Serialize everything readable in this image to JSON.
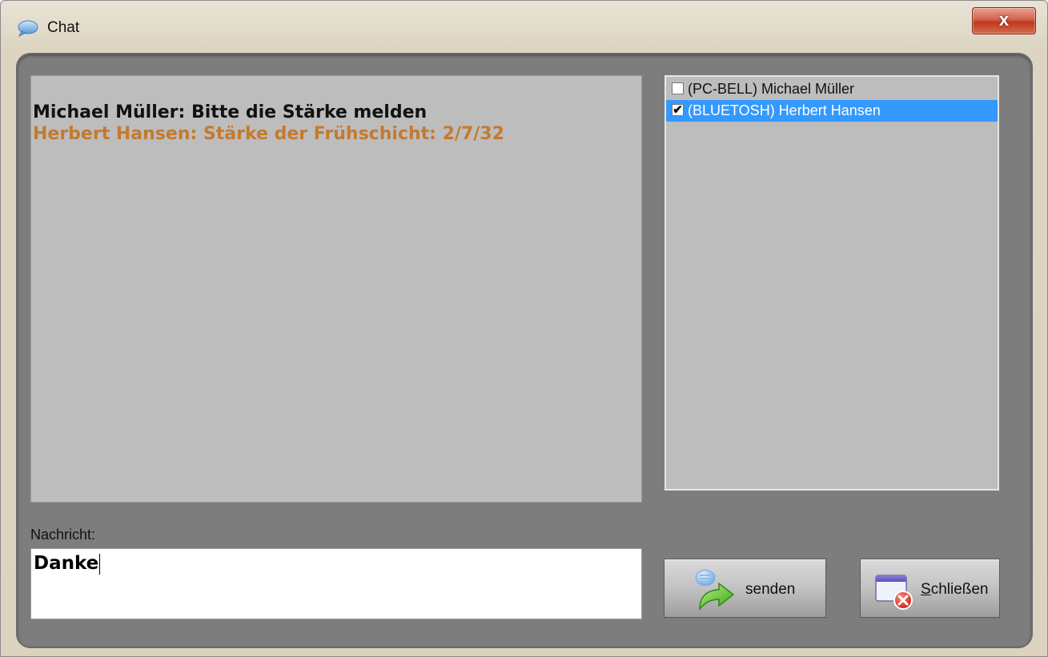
{
  "window": {
    "title": "Chat",
    "close_glyph": "x",
    "title_icon": "chat-bubble-icon"
  },
  "chat_log": {
    "messages": [
      {
        "text": "Michael Müller: Bitte die Stärke melden",
        "style": "self",
        "color": "#111111"
      },
      {
        "text": "Herbert Hansen: Stärke der Frühschicht: 2/7/32",
        "style": "other",
        "color": "#c47a2e"
      }
    ]
  },
  "user_list": {
    "items": [
      {
        "label": "(PC-BELL) Michael Müller",
        "checked": false,
        "selected": false
      },
      {
        "label": "(BLUETOSH) Herbert Hansen",
        "checked": true,
        "selected": true
      }
    ],
    "check_glyph": "✔",
    "selection_color": "#3399ff"
  },
  "message_input": {
    "label": "Nachricht:",
    "value": "Danke"
  },
  "buttons": {
    "send_label": "senden",
    "send_icon": "send-arrow-icon",
    "close_label": "Schließen",
    "close_icon": "close-window-icon"
  }
}
